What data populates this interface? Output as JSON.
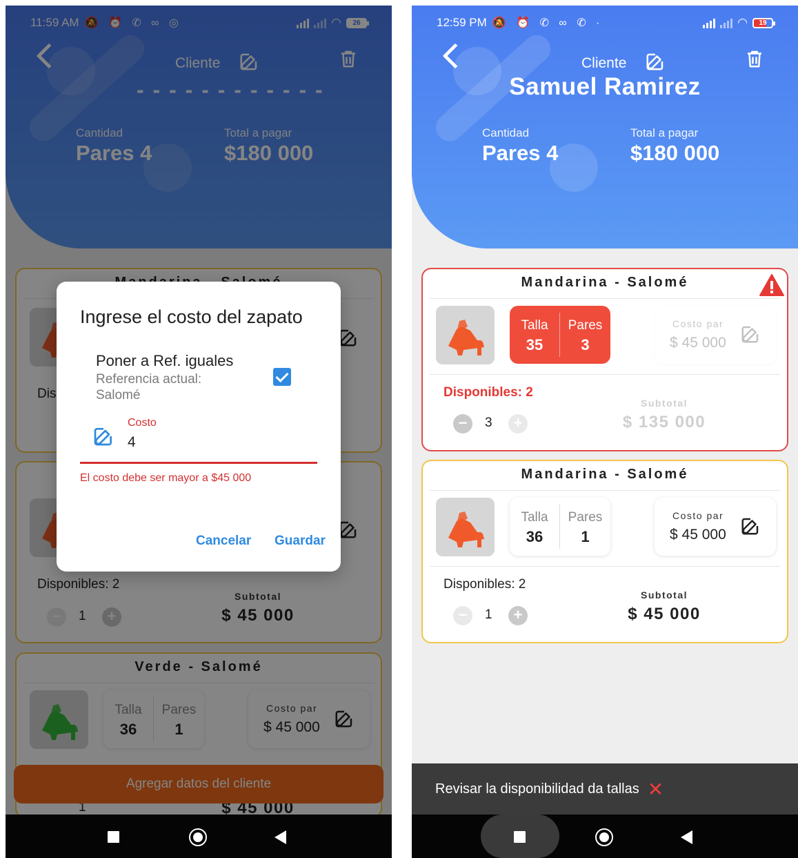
{
  "colors": {
    "header_gradient_top": "#4a7cf0",
    "header_gradient_bottom": "#5b9af4",
    "card_border": "#f2c64a",
    "error_red": "#e53935",
    "accent_blue": "#2f8ae0",
    "cta_orange": "#f26a1b"
  },
  "left": {
    "status": {
      "time": "11:59 AM",
      "glyphs": "🔕 ⏰ ✆ ∞ ◎",
      "battery": "26"
    },
    "header": {
      "client_label": "Cliente",
      "client_name_placeholder": "- - - - - - - - - - - -",
      "qty_label": "Cantidad",
      "qty_value": "Pares 4",
      "total_label": "Total a pagar",
      "total_value": "$180 000"
    },
    "cards": [
      {
        "title": "Mandarina - Salomé",
        "disponibles": "Dis"
      },
      {
        "title": "",
        "shoe_color": "orange",
        "disponibles": "Disponibles: 2",
        "qty": "1",
        "subtotal_label": "Subtotal",
        "subtotal_value": "$ 45 000"
      },
      {
        "title": "Verde - Salomé",
        "shoe_color": "green",
        "talla_label": "Talla",
        "talla_value": "36",
        "pares_label": "Pares",
        "pares_value": "1",
        "cost_label": "Costo par",
        "cost_value": "$ 45 000",
        "qty": "1",
        "subtotal_value": "$ 45 000"
      }
    ],
    "cta": "Agregar datos del cliente",
    "dialog": {
      "title": "Ingrese el costo del zapato",
      "option_label": "Poner a Ref. iguales",
      "option_sub": "Referencia actual: Salomé",
      "option_checked": true,
      "field_label": "Costo",
      "field_value": "4",
      "error": "El costo debe ser mayor a $45 000",
      "cancel": "Cancelar",
      "save": "Guardar"
    }
  },
  "right": {
    "status": {
      "time": "12:59 PM",
      "glyphs": "🔕 ⏰ ✆ ∞ ✆ ·",
      "battery": "19"
    },
    "header": {
      "client_label": "Cliente",
      "client_name": "Samuel Ramirez",
      "qty_label": "Cantidad",
      "qty_value": "Pares 4",
      "total_label": "Total a pagar",
      "total_value": "$180 000"
    },
    "cards": [
      {
        "title": "Mandarina - Salomé",
        "shoe_color": "orange",
        "warning": true,
        "talla_label": "Talla",
        "talla_value": "35",
        "pares_label": "Pares",
        "pares_value": "3",
        "cost_label": "Costo par",
        "cost_value": "$ 45 000",
        "disponibles": "Disponibles: 2",
        "qty": "3",
        "subtotal_label": "Subtotal",
        "subtotal_value": "$ 135 000"
      },
      {
        "title": "Mandarina - Salomé",
        "shoe_color": "orange",
        "talla_label": "Talla",
        "talla_value": "36",
        "pares_label": "Pares",
        "pares_value": "1",
        "cost_label": "Costo par",
        "cost_value": "$ 45 000",
        "disponibles": "Disponibles: 2",
        "qty": "1",
        "subtotal_label": "Subtotal",
        "subtotal_value": "$ 45 000"
      }
    ],
    "snackbar": {
      "message": "Revisar la disponibilidad da tallas",
      "close_icon": "close-icon"
    }
  }
}
